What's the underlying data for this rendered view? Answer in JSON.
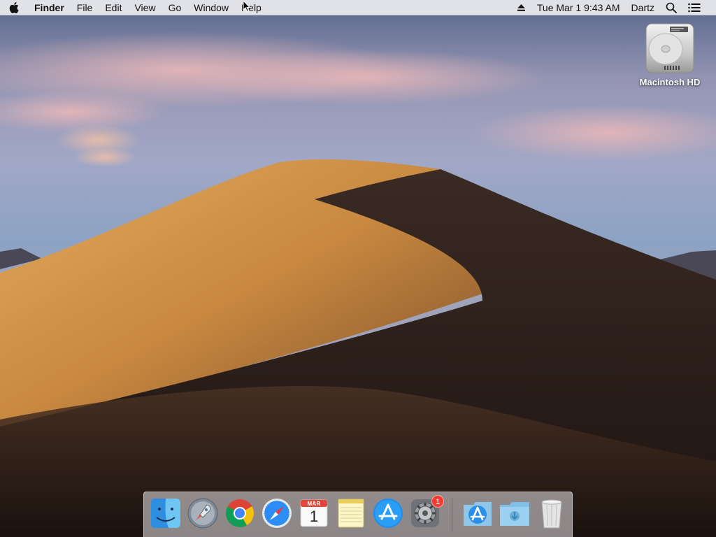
{
  "menubar": {
    "app_name": "Finder",
    "menus": [
      "File",
      "Edit",
      "View",
      "Go",
      "Window",
      "Help"
    ],
    "status": {
      "date": "Tue Mar 1",
      "time": "9:43 AM",
      "user": "Dartz"
    }
  },
  "desktop": {
    "icons": [
      {
        "label": "Macintosh HD",
        "icon": "hard-drive-icon"
      }
    ]
  },
  "dock": {
    "apps": [
      {
        "name": "Finder",
        "icon": "finder-icon",
        "running": true
      },
      {
        "name": "Launchpad",
        "icon": "launchpad-icon",
        "running": false
      },
      {
        "name": "Google Chrome",
        "icon": "chrome-icon",
        "running": false
      },
      {
        "name": "Safari",
        "icon": "safari-icon",
        "running": false
      },
      {
        "name": "Calendar",
        "icon": "calendar-icon",
        "running": false,
        "month": "MAR",
        "day": "1"
      },
      {
        "name": "Notes",
        "icon": "notes-icon",
        "running": false
      },
      {
        "name": "App Store",
        "icon": "app-store-icon",
        "running": false
      },
      {
        "name": "System Preferences",
        "icon": "system-preferences-icon",
        "running": false,
        "badge": "1"
      },
      {
        "name": "Applications",
        "icon": "applications-folder-icon",
        "running": false
      },
      {
        "name": "Downloads",
        "icon": "downloads-folder-icon",
        "running": false
      },
      {
        "name": "Trash",
        "icon": "trash-icon",
        "running": false
      }
    ]
  },
  "colors": {
    "menubar_bg": "#ececee",
    "badge": "#f23b32",
    "dune_light": "#d9a45a",
    "dune_shadow": "#3a2820",
    "sky": "#8aa0c2"
  }
}
